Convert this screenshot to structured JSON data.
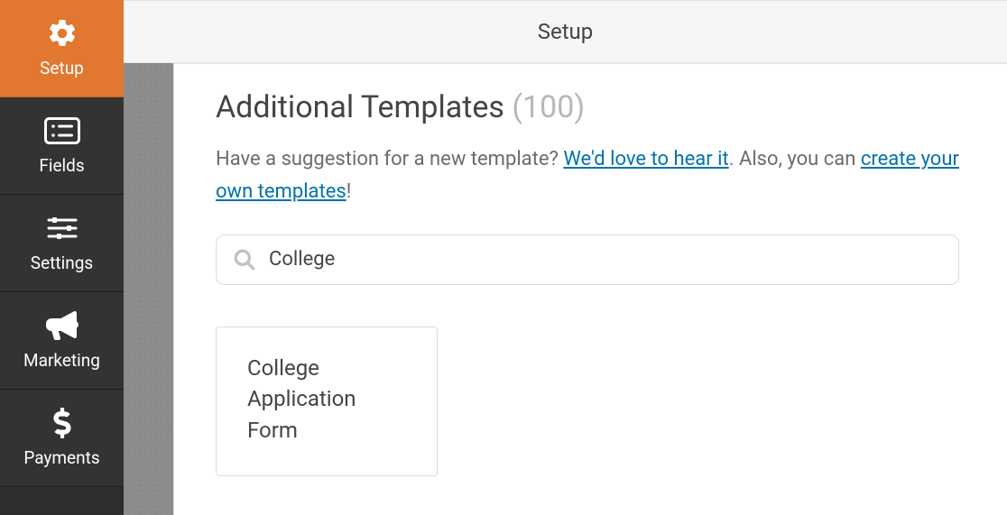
{
  "sidebar": {
    "items": [
      {
        "label": "Setup",
        "icon": "gear-icon"
      },
      {
        "label": "Fields",
        "icon": "list-icon"
      },
      {
        "label": "Settings",
        "icon": "sliders-icon"
      },
      {
        "label": "Marketing",
        "icon": "bullhorn-icon"
      },
      {
        "label": "Payments",
        "icon": "dollar-icon"
      }
    ]
  },
  "topbar": {
    "title": "Setup"
  },
  "page": {
    "heading": "Additional Templates",
    "count": "(100)",
    "desc_before_link1": "Have a suggestion for a new template? ",
    "link1": "We'd love to hear it",
    "desc_after_link1": ". Also, you can ",
    "link2": "create your own templates",
    "desc_after_link2": "!"
  },
  "search": {
    "value": "College"
  },
  "templates": [
    {
      "title": "College Application Form"
    }
  ]
}
